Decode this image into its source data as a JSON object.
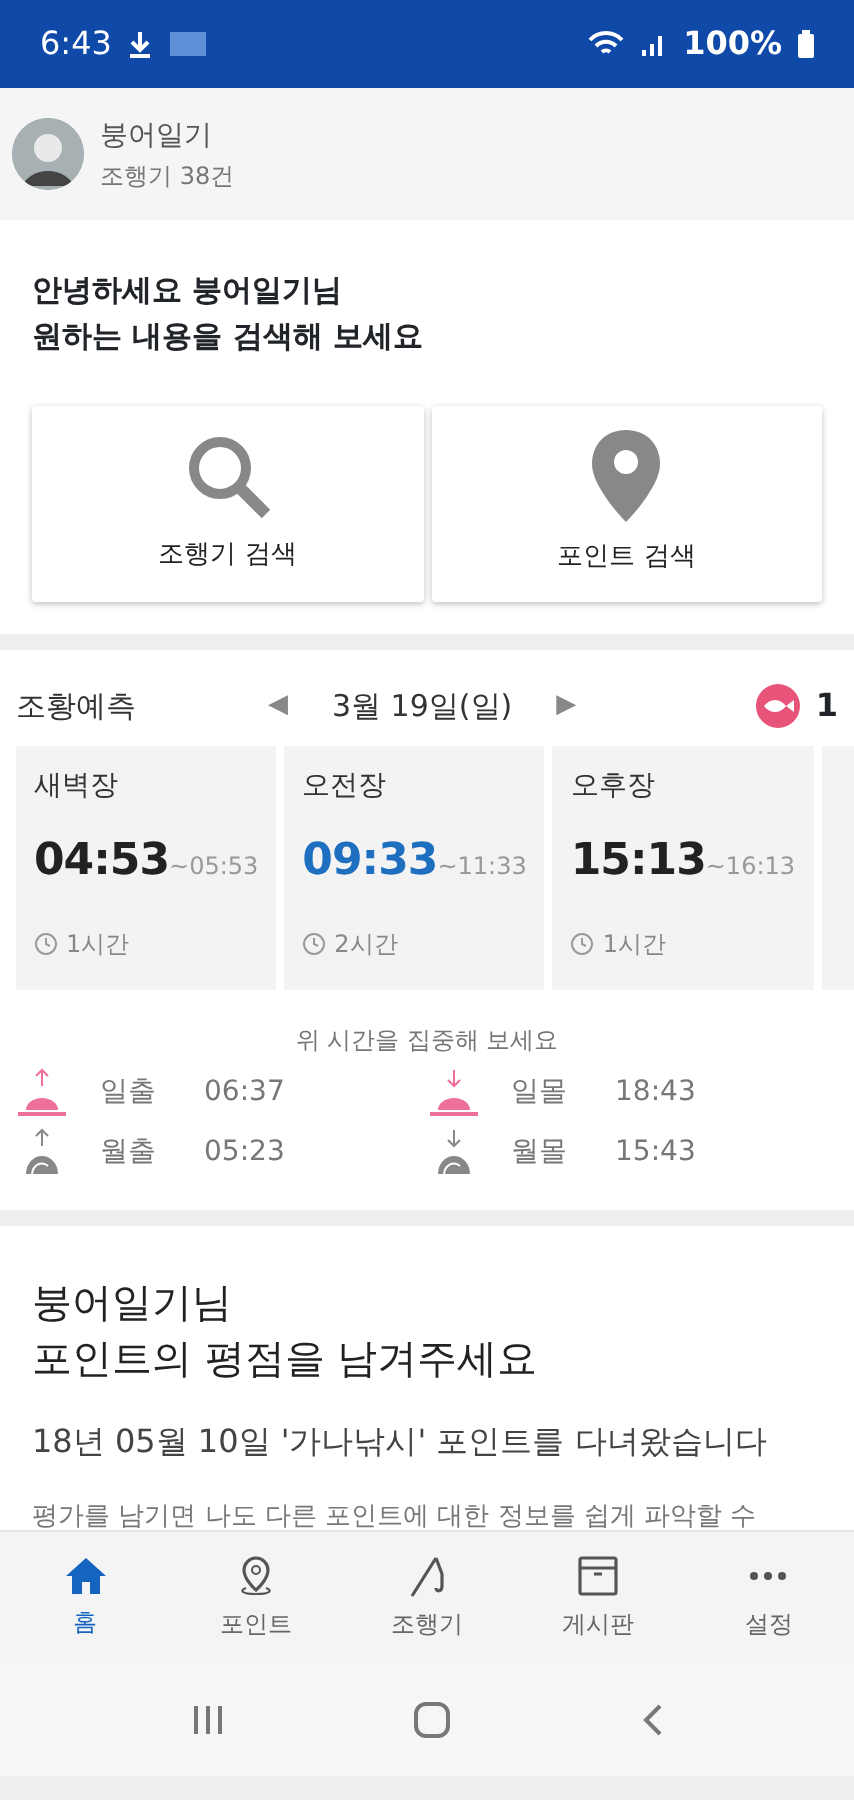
{
  "status_bar": {
    "time": "6:43",
    "battery": "100%"
  },
  "profile": {
    "name": "붕어일기",
    "count": "조행기 38건"
  },
  "greeting": {
    "lines": [
      "안녕하세요 붕어일기님",
      "원하는 내용을 검색해 보세요"
    ],
    "buttons": [
      {
        "kind": "search",
        "label": "조행기 검색"
      },
      {
        "kind": "pin",
        "label": "포인트 검색"
      }
    ]
  },
  "forecast": {
    "title": "조황예측",
    "prev": "◀",
    "date": "3월 19일(일)",
    "next": "▶",
    "fish_count": "1",
    "slots": [
      {
        "name": "새벽장",
        "start": "04:53",
        "end": "~05:53",
        "duration": "1시간",
        "highlight": false
      },
      {
        "name": "오전장",
        "start": "09:33",
        "end": "~11:33",
        "duration": "2시간",
        "highlight": true
      },
      {
        "name": "오후장",
        "start": "15:13",
        "end": "~16:13",
        "duration": "1시간",
        "highlight": false
      }
    ],
    "hint": "위 시간을 집중해 보세요",
    "astro": [
      {
        "kind": "sunrise",
        "label": "일출",
        "time": "06:37"
      },
      {
        "kind": "sunset",
        "label": "일몰",
        "time": "18:43"
      },
      {
        "kind": "moonrise",
        "label": "월출",
        "time": "05:23"
      },
      {
        "kind": "moonset",
        "label": "월몰",
        "time": "15:43"
      }
    ]
  },
  "review": {
    "lines": [
      "붕어일기님",
      "포인트의 평점을 남겨주세요"
    ],
    "visit": "18년 05월 10일 '가나낚시' 포인트를 다녀왔습니다",
    "body": "평가를 남기면 나도 다른 포인트에 대한 정보를 쉽게 파악할 수"
  },
  "bottom_nav": [
    {
      "kind": "home",
      "label": "홈",
      "selected": true
    },
    {
      "kind": "pin",
      "label": "포인트",
      "selected": false
    },
    {
      "kind": "rod",
      "label": "조행기",
      "selected": false
    },
    {
      "kind": "board",
      "label": "게시판",
      "selected": false
    },
    {
      "kind": "more",
      "label": "설정",
      "selected": false
    }
  ]
}
